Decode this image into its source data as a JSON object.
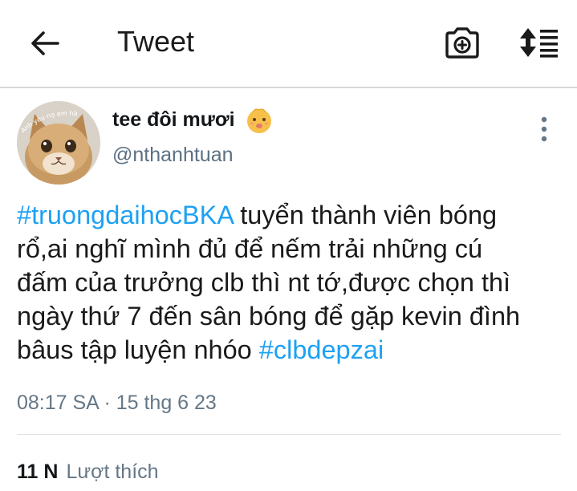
{
  "header": {
    "title": "Tweet",
    "back_icon": "back-arrow-icon",
    "camera_icon": "camera-add-icon",
    "sort_icon": "sort-icon"
  },
  "author": {
    "display_name": "tee đôi mươi",
    "name_emoji": "baby-face-emoji",
    "handle": "@nthanhtuan",
    "avatar_caption": "Anh yêu nọ em hả"
  },
  "tweet": {
    "lines": [
      [
        {
          "text": "#truongdaihocBKA",
          "hashtag": true
        },
        {
          "text": " tuyển thành viên bóng",
          "hashtag": false
        }
      ],
      [
        {
          "text": "rổ,ai nghĩ mình đủ để nếm trải những cú",
          "hashtag": false
        }
      ],
      [
        {
          "text": "đấm của trưởng clb thì nt tớ,được chọn thì",
          "hashtag": false
        }
      ],
      [
        {
          "text": "ngày thứ 7 đến sân bóng để gặp kevin đình",
          "hashtag": false
        }
      ],
      [
        {
          "text": "bâus tập luyện nhóo ",
          "hashtag": false
        },
        {
          "text": "#clbdepzai",
          "hashtag": true
        }
      ]
    ],
    "time": "08:17 SA",
    "separator": "·",
    "date": "15 thg 6 23"
  },
  "stats": {
    "likes_count": "11 N",
    "likes_label": "Lượt thích"
  },
  "colors": {
    "hashtag": "#1da1f2",
    "secondary_text": "#657786",
    "divider": "#dfe3e6"
  }
}
